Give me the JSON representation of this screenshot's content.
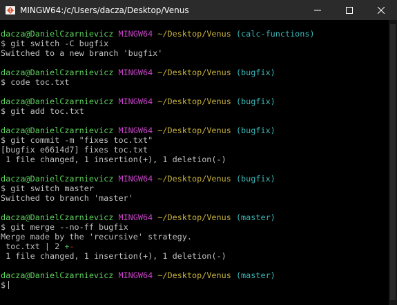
{
  "window": {
    "title": "MINGW64:/c/Users/dacza/Desktop/Venus",
    "icon": "git-bash-icon",
    "controls": [
      "minimize-icon",
      "maximize-icon",
      "close-icon"
    ]
  },
  "prompt": {
    "user_host": "dacza@DanielCzarnievicz",
    "env": "MINGW64",
    "path": "~/Desktop/Venus",
    "symbol": "$"
  },
  "colors": {
    "background": "#000000",
    "text": "#c0c0c0",
    "user_host": "#5fd35f",
    "env": "#cc44cc",
    "path": "#c8b33a",
    "branch": "#3ab8b8",
    "insertion": "#4ac04a",
    "deletion": "#cc3333"
  },
  "blocks": [
    {
      "branch": "(calc-functions)",
      "command": "git switch -C bugfix",
      "output": [
        "Switched to a new branch 'bugfix'"
      ]
    },
    {
      "branch": "(bugfix)",
      "command": "code toc.txt",
      "output": []
    },
    {
      "branch": "(bugfix)",
      "command": "git add toc.txt",
      "output": []
    },
    {
      "branch": "(bugfix)",
      "command": "git commit -m \"fixes toc.txt\"",
      "output": [
        "[bugfix e6614d7] fixes toc.txt",
        " 1 file changed, 1 insertion(+), 1 deletion(-)"
      ]
    },
    {
      "branch": "(bugfix)",
      "command": "git switch master",
      "output": [
        "Switched to branch 'master'"
      ]
    },
    {
      "branch": "(master)",
      "command": "git merge --no-ff bugfix",
      "output": [
        "Merge made by the 'recursive' strategy."
      ],
      "diffstat": {
        "file": " toc.txt | 2 ",
        "plus": "+",
        "minus": "-"
      },
      "summary": " 1 file changed, 1 insertion(+), 1 deletion(-)"
    },
    {
      "branch": "(master)",
      "command": "",
      "output": []
    }
  ]
}
